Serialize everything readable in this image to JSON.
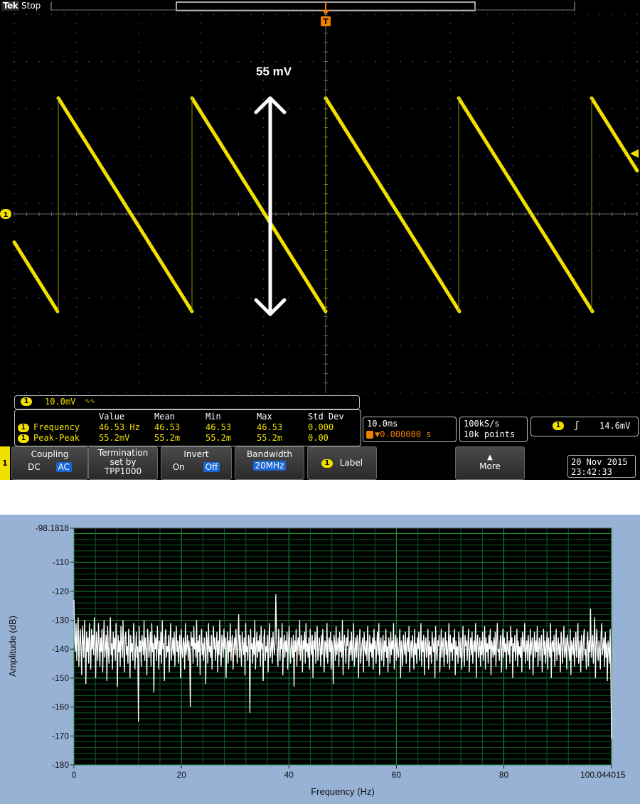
{
  "scope": {
    "brand": "Tek",
    "run_state": "Stop",
    "trigger_marker": "T",
    "channel": "1",
    "annotation": "55 mV",
    "channel_scale": "10.0mV",
    "channel_scale_suffix": "∿∿",
    "measurements": {
      "headers": [
        "Value",
        "Mean",
        "Min",
        "Max",
        "Std Dev"
      ],
      "rows": [
        {
          "name": "Frequency",
          "values": [
            "46.53 Hz",
            "46.53",
            "46.53",
            "46.53",
            "0.000"
          ]
        },
        {
          "name": "Peak-Peak",
          "values": [
            "55.2mV",
            "55.2m",
            "55.2m",
            "55.2m",
            "0.00"
          ]
        }
      ]
    },
    "timebase": "10.0ms",
    "trigger_delay": "▼0.000000 s",
    "sample_rate": "100kS/s",
    "record_length": "10k points",
    "trigger_slope": "ʃ",
    "trigger_level": "14.6mV",
    "buttons": {
      "coupling_label": "Coupling",
      "coupling_dc": "DC",
      "coupling_ac": "AC",
      "termination_line1": "Termination",
      "termination_line2": "set by",
      "termination_line3": "TPP1000",
      "invert_label": "Invert",
      "invert_on": "On",
      "invert_off": "Off",
      "bandwidth_label": "Bandwidth",
      "bandwidth_value": "20MHz",
      "label_button": "Label",
      "more_button": "More"
    },
    "date": "20 Nov 2015",
    "time": "23:42:33",
    "colors": {
      "trace": "#f0e000",
      "background": "#000000",
      "grid": "#555555"
    }
  },
  "chart_data": {
    "type": "line",
    "xlabel": "Frequency (Hz)",
    "ylabel": "Amplitude (dB)",
    "xlim": [
      0,
      100.044015
    ],
    "ylim": [
      -180,
      -98.1818
    ],
    "x_ticks": [
      "0",
      "20",
      "40",
      "60",
      "80",
      "100.044015"
    ],
    "y_ticks": [
      "-98.1818",
      "-110",
      "-120",
      "-130",
      "-140",
      "-150",
      "-160",
      "-170",
      "-180"
    ],
    "grid": true,
    "series": [
      {
        "values": [
          -123,
          -136,
          -141,
          -131,
          -144,
          -135,
          -129,
          -146,
          -138,
          -133,
          -140,
          -149,
          -132,
          -137,
          -143,
          -130,
          -139,
          -152,
          -134,
          -141,
          -136,
          -145,
          -131,
          -138,
          -147,
          -133,
          -140,
          -135,
          -142,
          -129,
          -137,
          -150,
          -134,
          -139,
          -144,
          -131,
          -138,
          -146,
          -136,
          -141,
          -133,
          -148,
          -137,
          -130,
          -143,
          -139,
          -135,
          -151,
          -132,
          -140,
          -145,
          -136,
          -129,
          -142,
          -138,
          -147,
          -134,
          -140,
          -136,
          -144,
          -131,
          -139,
          -153,
          -135,
          -141,
          -137,
          -146,
          -132,
          -138,
          -143,
          -130,
          -140,
          -148,
          -136,
          -134,
          -142,
          -139,
          -145,
          -133,
          -137,
          -150,
          -135,
          -141,
          -138,
          -144,
          -131,
          -136,
          -147,
          -140,
          -134,
          -143,
          -139,
          -165,
          -132,
          -141,
          -137,
          -146,
          -135,
          -138,
          -142,
          -130,
          -144,
          -136,
          -140,
          -149,
          -133,
          -137,
          -143,
          -139,
          -134,
          -146,
          -131,
          -141,
          -138,
          -155,
          -135,
          -140,
          -136,
          -144,
          -132,
          -139,
          -147,
          -137,
          -142,
          -134,
          -145,
          -130,
          -140,
          -138,
          -151,
          -136,
          -133,
          -143,
          -139,
          -141,
          -135,
          -148,
          -137,
          -131,
          -144,
          -140,
          -136,
          -142,
          -134,
          -146,
          -138,
          -132,
          -141,
          -137,
          -145,
          -139,
          -135,
          -150,
          -133,
          -140,
          -143,
          -136,
          -138,
          -147,
          -131,
          -142,
          -139,
          -135,
          -144,
          -137,
          -141,
          -160,
          -134,
          -139,
          -136,
          -145,
          -132,
          -140,
          -138,
          -143,
          -130,
          -146,
          -137,
          -141,
          -135,
          -149,
          -139,
          -133,
          -142,
          -138,
          -144,
          -136,
          -140,
          -152,
          -134,
          -137,
          -145,
          -131,
          -141,
          -139,
          -143,
          -135,
          -147,
          -138,
          -132,
          -140,
          -136,
          -144,
          -139,
          -134,
          -148,
          -137,
          -142,
          -130,
          -141,
          -146,
          -135,
          -138,
          -143,
          -133,
          -140,
          -136,
          -150,
          -139,
          -134,
          -145,
          -137,
          -141,
          -131,
          -144,
          -138,
          -135,
          -147,
          -140,
          -136,
          -142,
          -133,
          -139,
          -145,
          -137,
          -128,
          -143,
          -135,
          -140,
          -146,
          -134,
          -138,
          -142,
          -136,
          -149,
          -131,
          -141,
          -139,
          -144,
          -135,
          -137,
          -162,
          -133,
          -140,
          -138,
          -145,
          -136,
          -142,
          -130,
          -147,
          -139,
          -134,
          -143,
          -137,
          -141,
          -135,
          -146,
          -132,
          -140,
          -138,
          -151,
          -136,
          -133,
          -144,
          -139,
          -141,
          -135,
          -148,
          -137,
          -131,
          -143,
          -140,
          -136,
          -145,
          -134,
          -139,
          -142,
          -137,
          -121,
          -135,
          -141,
          -146,
          -133,
          -138,
          -144,
          -136,
          -140,
          -131,
          -149,
          -139,
          -135,
          -143,
          -137,
          -141,
          -134,
          -147,
          -138,
          -132,
          -140,
          -145,
          -136,
          -139,
          -143,
          -135,
          -153,
          -137,
          -141,
          -133,
          -146,
          -138,
          -136,
          -142,
          -130,
          -144,
          -139,
          -135,
          -148,
          -137,
          -140,
          -134,
          -145,
          -131,
          -141,
          -138,
          -143,
          -136,
          -147,
          -133,
          -139,
          -142,
          -135,
          -150,
          -137,
          -140,
          -134,
          -145,
          -138,
          -132,
          -144,
          -141,
          -136,
          -139,
          -146,
          -135,
          -142,
          -133,
          -140,
          -148,
          -137,
          -138,
          -143,
          -131,
          -145,
          -139,
          -136,
          -141,
          -134,
          -147,
          -137,
          -140,
          -152,
          -135,
          -138,
          -144,
          -132,
          -142,
          -139,
          -136,
          -146,
          -134,
          -141,
          -137,
          -143,
          -130,
          -149,
          -138,
          -135,
          -140,
          -145,
          -136,
          -139,
          -133,
          -147,
          -141,
          -137,
          -142,
          -134,
          -144,
          -138,
          -131,
          -146,
          -140,
          -136,
          -143,
          -135,
          -139,
          -150,
          -137,
          -133,
          -145,
          -141,
          -138,
          -136,
          -148,
          -134,
          -140,
          -142,
          -137,
          -144,
          -132,
          -139,
          -146,
          -135,
          -141,
          -138,
          -143,
          -136,
          -147,
          -133,
          -140,
          -137,
          -145,
          -139,
          -134,
          -142,
          -131,
          -149,
          -138,
          -136,
          -144,
          -140,
          -135,
          -146,
          -137,
          -141,
          -133,
          -143,
          -139,
          -148,
          -136,
          -138,
          -145,
          -134,
          -142,
          -137,
          -140,
          -131,
          -147,
          -139,
          -135,
          -144,
          -136,
          -141,
          -143,
          -138,
          -133,
          -150,
          -137,
          -140,
          -146,
          -135,
          -139,
          -142,
          -134,
          -145,
          -138,
          -136,
          -141,
          -132,
          -148,
          -140,
          -137,
          -143,
          -135,
          -139,
          -147,
          -133,
          -142,
          -138,
          -145,
          -136,
          -140,
          -134,
          -144,
          -139,
          -131,
          -146,
          -137,
          -141,
          -135,
          -149,
          -138,
          -136,
          -143,
          -140,
          -133,
          -147,
          -137,
          -142,
          -139,
          -145,
          -134,
          -138,
          -141,
          -136,
          -150,
          -132,
          -140,
          -144,
          -137,
          -139,
          -135,
          -148,
          -141,
          -133,
          -143,
          -138,
          -136,
          -146,
          -140,
          -134,
          -142,
          -137,
          -145,
          -139,
          -131,
          -147,
          -135,
          -141,
          -138,
          -144,
          -136,
          -140,
          -133,
          -149,
          -137,
          -142,
          -139,
          -145,
          -134,
          -138,
          -143,
          -136,
          -147,
          -141,
          -132,
          -140,
          -146,
          -135,
          -139,
          -137,
          -144,
          -138,
          -133,
          -148,
          -140,
          -136,
          -142,
          -134,
          -145,
          -139,
          -137,
          -141,
          -131,
          -150,
          -138,
          -135,
          -143,
          -140,
          -136,
          -146,
          -137,
          -142,
          -134,
          -144,
          -139,
          -132,
          -147,
          -136,
          -141,
          -138,
          -145,
          -135,
          -140,
          -133,
          -149,
          -137,
          -139,
          -143,
          -136,
          -142,
          -134,
          -146,
          -138,
          -131,
          -141,
          -140,
          -144,
          -137,
          -135,
          -148,
          -139,
          -133,
          -143,
          -136,
          -141,
          -138,
          -147,
          -134,
          -140,
          -142,
          -137,
          -145,
          -132,
          -139,
          -136,
          -150,
          -138,
          -141,
          -135,
          -144,
          -140,
          -133,
          -146,
          -137,
          -142,
          -139,
          -143,
          -136,
          -148,
          -134,
          -138,
          -141,
          -131,
          -145,
          -140,
          -137,
          -144,
          -135,
          -139,
          -147,
          -133,
          -142,
          -138,
          -136,
          -149,
          -140,
          -134,
          -143,
          -137,
          -141,
          -132,
          -146,
          -139,
          -136,
          -144,
          -138,
          -135,
          -148,
          -141,
          -133,
          -142,
          -137,
          -145,
          -139,
          -134,
          -147,
          -136,
          -140,
          -143,
          -131,
          -150,
          -138,
          -137,
          -141,
          -135,
          -146,
          -139,
          -133,
          -144,
          -140,
          -136,
          -142,
          -138,
          -148,
          -134,
          -137,
          -145,
          -139,
          -132,
          -143,
          -141,
          -136,
          -147,
          -135,
          -138,
          -140,
          -144,
          -133,
          -149,
          -137,
          -139,
          -142,
          -136,
          -146,
          -140,
          -134,
          -143,
          -138,
          -131,
          -145,
          -141,
          -137,
          -148,
          -135,
          -139,
          -144,
          -136,
          -133,
          -142,
          -140,
          -147,
          -138,
          -134,
          -146,
          -137,
          -141,
          -126,
          -143,
          -139,
          -135,
          -145,
          -136,
          -129,
          -150,
          -138,
          -133,
          -141,
          -144,
          -137,
          -140,
          -147,
          -135,
          -131,
          -142,
          -139,
          -136,
          -146,
          -134,
          -143,
          -138,
          -151,
          -137,
          -140,
          -145,
          -133,
          -149,
          -171
        ]
      }
    ]
  }
}
